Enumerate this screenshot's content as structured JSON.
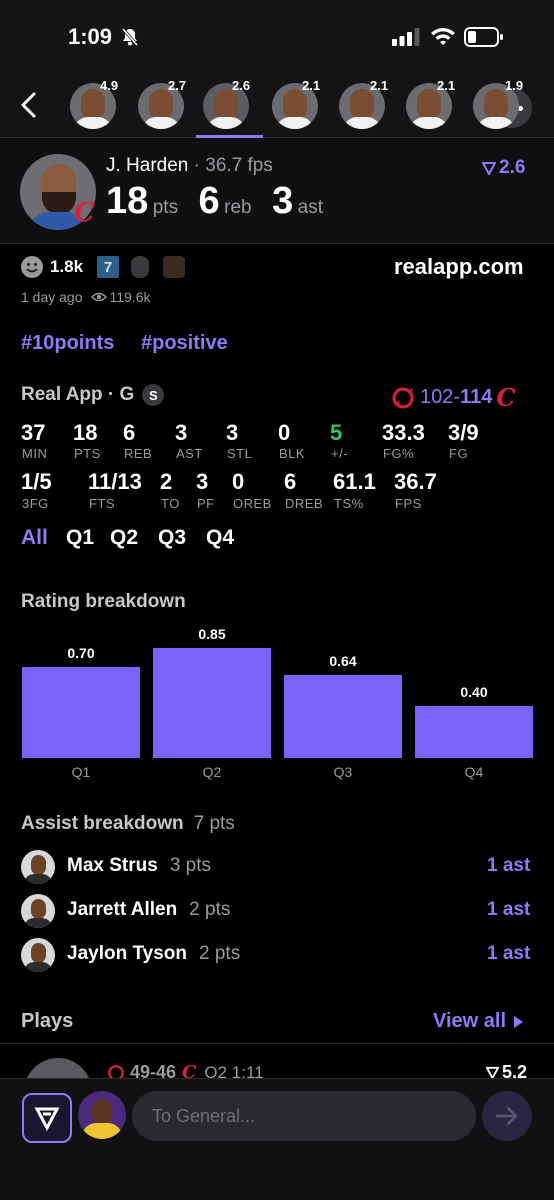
{
  "status": {
    "time": "1:09"
  },
  "player_strip": [
    {
      "score": "4.9"
    },
    {
      "score": "2.7"
    },
    {
      "score": "2.6",
      "selected": true
    },
    {
      "score": "2.1"
    },
    {
      "score": "2.1"
    },
    {
      "score": "2.1"
    },
    {
      "score": "1.9"
    }
  ],
  "player": {
    "name": "J. Harden",
    "fps": "36.7 fps",
    "rating": "2.6",
    "pts": "18",
    "pts_label": "pts",
    "reb": "6",
    "reb_label": "reb",
    "ast": "3",
    "ast_label": "ast"
  },
  "meta": {
    "reactions": "1.8k",
    "badge_number": "7",
    "time_ago": "1 day ago",
    "views": "119.6k",
    "site": "realapp.com"
  },
  "tags": [
    "#10points",
    "#positive"
  ],
  "game": {
    "source": "Real App · G",
    "source_badge": "S",
    "score_away": "102",
    "score_sep": "-",
    "score_home": "114"
  },
  "stats_row1": [
    {
      "value": "37",
      "label": "MIN"
    },
    {
      "value": "18",
      "label": "PTS"
    },
    {
      "value": "6",
      "label": "REB"
    },
    {
      "value": "3",
      "label": "AST"
    },
    {
      "value": "3",
      "label": "STL"
    },
    {
      "value": "0",
      "label": "BLK"
    },
    {
      "value": "5",
      "label": "+/-"
    },
    {
      "value": "33.3",
      "label": "FG%"
    },
    {
      "value": "3/9",
      "label": "FG"
    }
  ],
  "stats_row2": [
    {
      "value": "1/5",
      "label": "3FG"
    },
    {
      "value": "11/13",
      "label": "FTS"
    },
    {
      "value": "2",
      "label": "TO"
    },
    {
      "value": "3",
      "label": "PF"
    },
    {
      "value": "0",
      "label": "OREB"
    },
    {
      "value": "6",
      "label": "DREB"
    },
    {
      "value": "61.1",
      "label": "TS%"
    },
    {
      "value": "36.7",
      "label": "FPS"
    }
  ],
  "period_tabs": [
    "All",
    "Q1",
    "Q2",
    "Q3",
    "Q4"
  ],
  "rating_section_title": "Rating breakdown",
  "chart_data": {
    "type": "bar",
    "categories": [
      "Q1",
      "Q2",
      "Q3",
      "Q4"
    ],
    "values": [
      0.7,
      0.85,
      0.64,
      0.4
    ],
    "value_labels": [
      "0.70",
      "0.85",
      "0.64",
      "0.40"
    ],
    "ylim": [
      0,
      0.85
    ],
    "color": "#7b63f7"
  },
  "assist": {
    "title": "Assist breakdown",
    "total": "7 pts",
    "items": [
      {
        "name": "Max Strus",
        "pts": "3 pts",
        "ast": "1 ast"
      },
      {
        "name": "Jarrett Allen",
        "pts": "2 pts",
        "ast": "1 ast"
      },
      {
        "name": "Jaylon Tyson",
        "pts": "2 pts",
        "ast": "1 ast"
      }
    ]
  },
  "plays": {
    "title": "Plays",
    "view_all": "View all",
    "first": {
      "score": "49-46",
      "period_time": "Q2 1:11",
      "rating": "5.2"
    }
  },
  "composer": {
    "placeholder": "To General..."
  },
  "colors": {
    "accent": "#8b7cf6",
    "bar": "#7b63f7",
    "positive": "#35c270",
    "raptors": "#e01e3c",
    "background": "#000000"
  }
}
